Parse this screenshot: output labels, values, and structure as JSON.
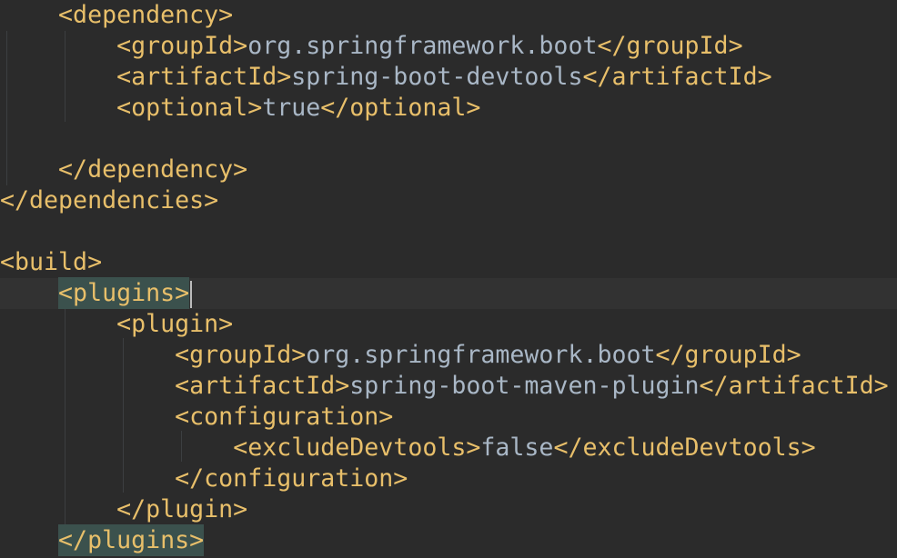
{
  "editor": {
    "lines": [
      {
        "indent": "    ",
        "open": "<dependency>",
        "content": "",
        "close": ""
      },
      {
        "indent": "        ",
        "open": "<groupId>",
        "content": "org.springframework.boot",
        "close": "</groupId>"
      },
      {
        "indent": "        ",
        "open": "<artifactId>",
        "content": "spring-boot-devtools",
        "close": "</artifactId>"
      },
      {
        "indent": "        ",
        "open": "<optional>",
        "content": "true",
        "close": "</optional>"
      },
      {
        "indent": "",
        "open": "",
        "content": "",
        "close": ""
      },
      {
        "indent": "    ",
        "open": "</dependency>",
        "content": "",
        "close": ""
      },
      {
        "indent": "",
        "open": "</dependencies>",
        "content": "",
        "close": ""
      },
      {
        "indent": "",
        "open": "",
        "content": "",
        "close": ""
      },
      {
        "indent": "",
        "open": "<build>",
        "content": "",
        "close": ""
      },
      {
        "indent": "    ",
        "open": "<plugins>",
        "content": "",
        "close": ""
      },
      {
        "indent": "        ",
        "open": "<plugin>",
        "content": "",
        "close": ""
      },
      {
        "indent": "            ",
        "open": "<groupId>",
        "content": "org.springframework.boot",
        "close": "</groupId>"
      },
      {
        "indent": "            ",
        "open": "<artifactId>",
        "content": "spring-boot-maven-plugin",
        "close": "</artifactId>"
      },
      {
        "indent": "            ",
        "open": "<configuration>",
        "content": "",
        "close": ""
      },
      {
        "indent": "                ",
        "open": "<excludeDevtools>",
        "content": "false",
        "close": "</excludeDevtools>"
      },
      {
        "indent": "            ",
        "open": "</configuration>",
        "content": "",
        "close": ""
      },
      {
        "indent": "        ",
        "open": "</plugin>",
        "content": "",
        "close": ""
      },
      {
        "indent": "    ",
        "open": "</plugins>",
        "content": "",
        "close": ""
      }
    ]
  },
  "theme": {
    "background": "#2b2b2b",
    "tag_color": "#e8bf6a",
    "text_color": "#a9b7c6",
    "tag_match_highlight": "#3b514d",
    "current_line": "#323232"
  }
}
